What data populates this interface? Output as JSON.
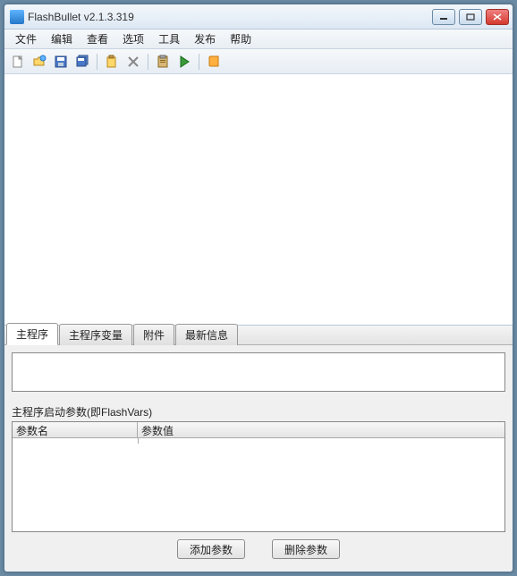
{
  "window": {
    "title": "FlashBullet v2.1.3.319"
  },
  "menu": {
    "file": "文件",
    "edit": "编辑",
    "view": "查看",
    "options": "选项",
    "tools": "工具",
    "publish": "发布",
    "help": "帮助"
  },
  "toolbar_icons": {
    "new": "new-file-icon",
    "open": "open-folder-icon",
    "save": "save-icon",
    "saveall": "save-all-icon",
    "paste": "paste-icon",
    "delete": "delete-icon",
    "clipboard": "clipboard-icon",
    "run": "run-icon",
    "help": "help-book-icon"
  },
  "tabs": {
    "main": "主程序",
    "vars": "主程序变量",
    "attach": "附件",
    "latest": "最新信息"
  },
  "panel": {
    "params_label": "主程序启动参数(即FlashVars)",
    "col_name": "参数名",
    "col_value": "参数值",
    "btn_add": "添加参数",
    "btn_del": "删除参数"
  }
}
